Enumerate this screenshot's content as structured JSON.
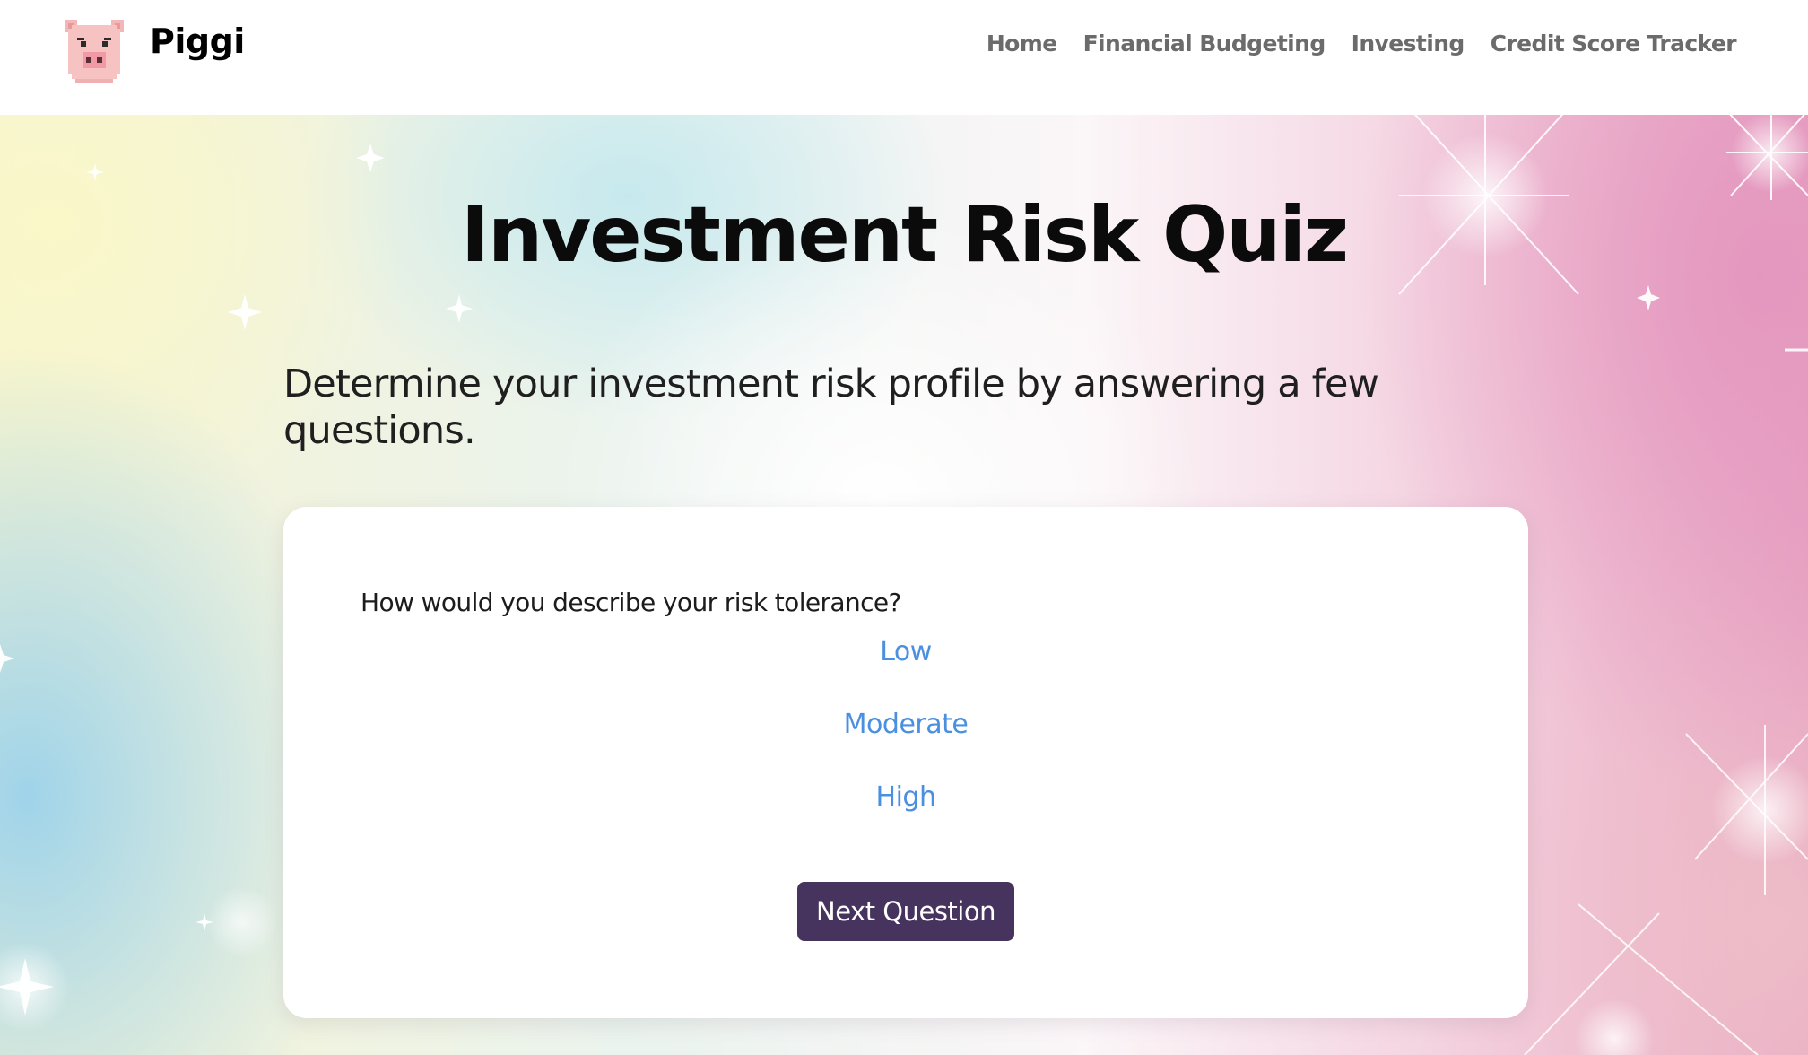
{
  "header": {
    "brand": "Piggi",
    "logo_icon": "pig-icon",
    "nav": [
      {
        "label": "Home"
      },
      {
        "label": "Financial Budgeting"
      },
      {
        "label": "Investing"
      },
      {
        "label": "Credit Score Tracker"
      }
    ]
  },
  "main": {
    "title": "Investment Risk Quiz",
    "subtitle": "Determine your investment risk profile by answering a few questions."
  },
  "quiz": {
    "question": "How would you describe your risk tolerance?",
    "options": [
      {
        "label": "Low"
      },
      {
        "label": "Moderate"
      },
      {
        "label": "High"
      }
    ],
    "next_label": "Next Question"
  },
  "colors": {
    "accent": "#4a8fe0",
    "button": "#46345f",
    "nav_text": "#6b6b6b"
  }
}
